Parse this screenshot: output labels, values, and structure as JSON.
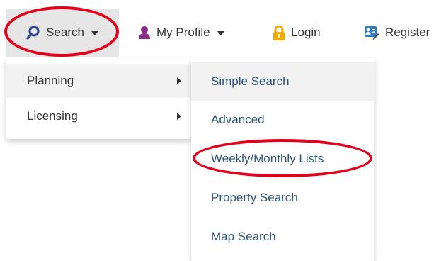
{
  "navbar": {
    "search_label": "Search",
    "profile_label": "My Profile",
    "login_label": "Login",
    "register_label": "Register"
  },
  "search_menu": {
    "items": [
      {
        "label": "Planning",
        "has_submenu": true,
        "active": true
      },
      {
        "label": "Licensing",
        "has_submenu": true,
        "active": false
      }
    ]
  },
  "planning_submenu": {
    "items": [
      {
        "label": "Simple Search",
        "active": true
      },
      {
        "label": "Advanced",
        "active": false
      },
      {
        "label": "Weekly/Monthly Lists",
        "active": false
      },
      {
        "label": "Property Search",
        "active": false
      },
      {
        "label": "Map Search",
        "active": false
      }
    ]
  },
  "icons": {
    "search": "search-icon",
    "profile": "user-icon",
    "login": "lock-icon",
    "register": "register-icon"
  },
  "colors": {
    "search_icon": "#2a3f8f",
    "profile_icon": "#8a2b8a",
    "lock_icon": "#f2a900",
    "register_icon": "#2f7ac6",
    "submenu_text": "#2f5479",
    "highlight": "#e3001b"
  }
}
